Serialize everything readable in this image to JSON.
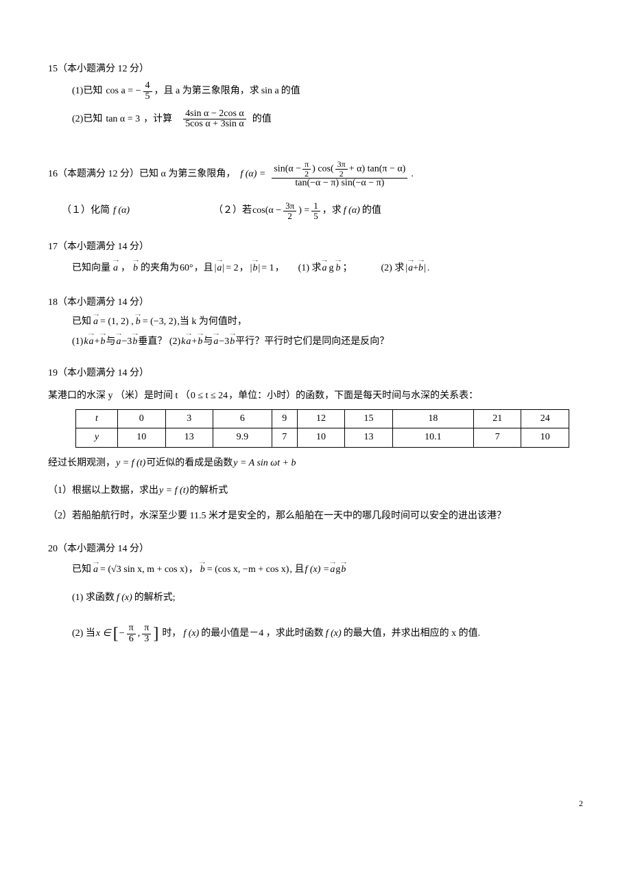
{
  "page_number": "2",
  "problems": {
    "p15": {
      "header": "15（本小题满分 12 分）",
      "part1_a": "(1)已知",
      "part1_b": "cos a = −",
      "part1_frac_num": "4",
      "part1_frac_den": "5",
      "part1_c": "，且 a 为第三象限角，求",
      "part1_d": "sin a",
      "part1_e": " 的值",
      "part2_a": "(2)已知",
      "part2_b": "tan α = 3",
      "part2_c": "，计算",
      "part2_frac_num": "4sin α − 2cos α",
      "part2_frac_den": "5cos α + 3sin α",
      "part2_d": " 的值"
    },
    "p16": {
      "header_a": "16（本题满分 12 分）已知 α 为第三象限角，",
      "fa": "f (α) =",
      "num_a": "sin(α −",
      "num_b": ") cos(",
      "num_c": "+ α) tan(π − α)",
      "den": "tan(−α − π) sin(−α − π)",
      "dot": ".",
      "s1_a": "（１）化简",
      "s1_b": "f (α)",
      "s2_a": "（２）若",
      "s2_b": "cos(α −",
      "s2_c": ") =",
      "s2_d": "，求",
      "s2_e": "f (α)",
      "s2_f": " 的值"
    },
    "p17": {
      "header": "17（本小题满分 14 分）",
      "line_a": "已知向量",
      "line_b": "，",
      "line_c": " 的夹角为",
      "angle": "60°",
      "line_d": "，且",
      "eq1": "= 2",
      "line_e": "，",
      "eq2": "= 1",
      "line_f": "，",
      "q1_a": "(1)  求 ",
      "q1_b": "；",
      "q2_a": "(2)  求  ",
      "q2_b": "."
    },
    "p18": {
      "header": "18（本小题满分 14 分）",
      "line1_a": "已知",
      "line1_b": " = (1, 2) ,",
      "line1_c": " = (−3, 2)",
      "line1_d": " ,当 k 为何值时，",
      "line2_a": "(1)  ",
      "line2_b": " 与 ",
      "line2_c": " 垂直？    (2)  ",
      "line2_d": " 与 ",
      "line2_e": " 平行？平行时它们是同向还是反向？"
    },
    "p19": {
      "header": "19（本小题满分 14 分）",
      "intro_a": "某港口的水深 y （米）是时间 t （",
      "intro_b": "0 ≤ t ≤ 24",
      "intro_c": " ，单位：小时）的函数，下面是每天时间与水深的关系表：",
      "after_table_a": "经过长期观测，   ",
      "after_table_b": "y = f (t)",
      "after_table_c": " 可近似的看成是函数 ",
      "after_table_d": "y = A sin ωt + b",
      "q1_a": "（1）根据以上数据，求出 ",
      "q1_b": "y = f (t)",
      "q1_c": " 的解析式",
      "q2": "（2）若船舶航行时，水深至少要 11.5 米才是安全的，那么船舶在一天中的哪几段时间可以安全的进出该港？"
    },
    "p20": {
      "header": "20（本小题满分 14 分）",
      "line1_a": "已知",
      "line1_b": " = (√3 sin x, m + cos x)",
      "line1_c": "，",
      "line1_d": " = (cos x, −m + cos x)",
      "line1_e": " , 且 ",
      "line1_f": "f (x) = ",
      "q1_a": "(1)  求函数",
      "q1_b": "f (x)",
      "q1_c": " 的解析式;",
      "q2_a": "(2)  当 ",
      "q2_b": "x ∈",
      "q2_c": "时，",
      "q2_d": "f (x)",
      "q2_e": " 的最小值是－4 ，求此时函数",
      "q2_f": "f (x)",
      "q2_g": " 的最大值，并求出相应的 x 的值."
    }
  },
  "table19": {
    "row1": [
      "t",
      "0",
      "3",
      "6",
      "9",
      "12",
      "15",
      "18",
      "21",
      "24"
    ],
    "row2": [
      "y",
      "10",
      "13",
      "9.9",
      "7",
      "10",
      "13",
      "10.1",
      "7",
      "10"
    ]
  },
  "fracs": {
    "pi2_n": "π",
    "pi2_d": "2",
    "3pi2_n": "3π",
    "3pi2_d": "2",
    "15_n": "1",
    "15_d": "5",
    "pi6_n": "π",
    "pi6_d": "6",
    "pi3_n": "π",
    "pi3_d": "3"
  }
}
